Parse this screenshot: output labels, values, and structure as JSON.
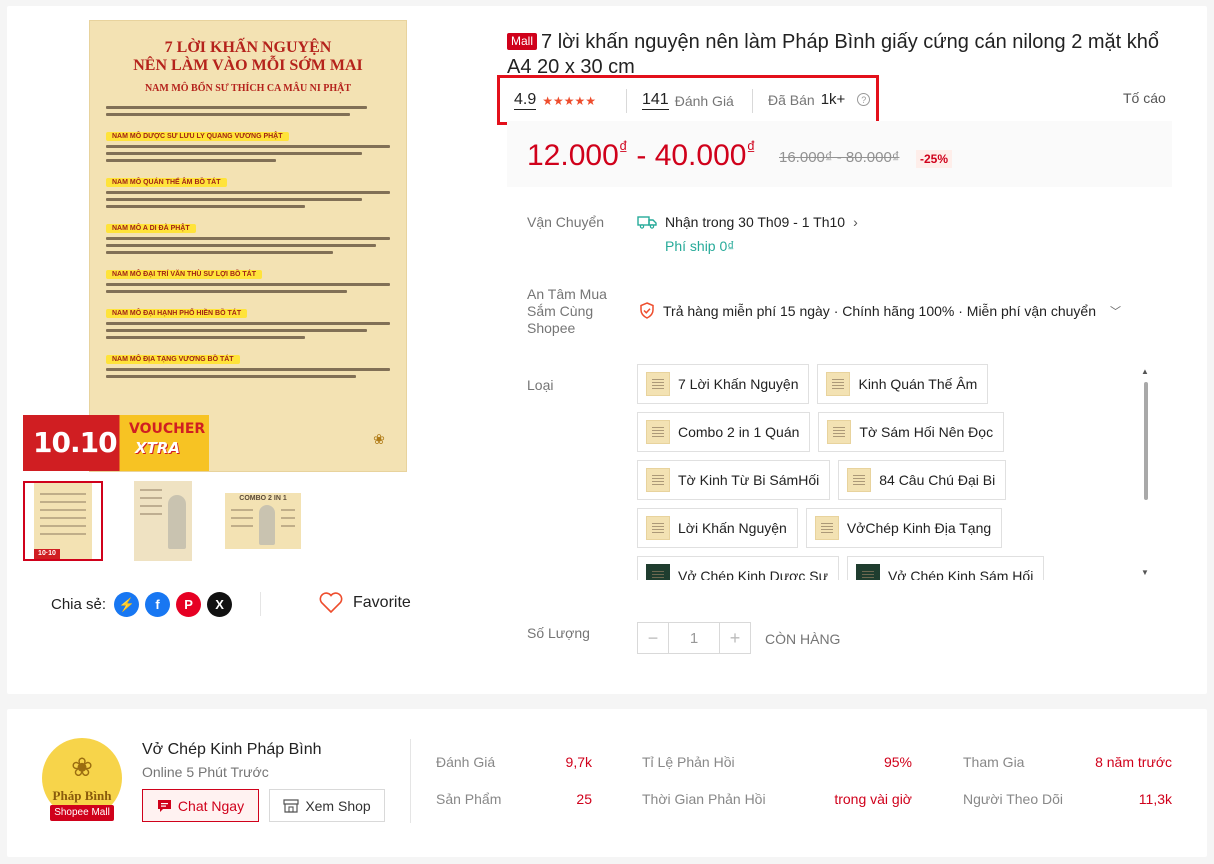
{
  "product": {
    "mall_tag": "Mall",
    "title": "7 lời khấn nguyện nên làm Pháp Bình giấy cứng cán nilong 2 mặt khổ A4 20 x 30 cm",
    "rating": "4.9",
    "rating_stars": 5,
    "reviews_count": "141",
    "reviews_label": "Đánh Giá",
    "sold_label": "Đã Bán",
    "sold_count": "1k+",
    "report_label": "Tố cáo",
    "price": "12.000",
    "price_max": "40.000",
    "currency": "₫",
    "old_price": "16.000₫ - 80.000₫",
    "discount": "-25%"
  },
  "poster": {
    "title_line1": "7 LỜI KHẤN NGUYỆN",
    "title_line2": "NÊN LÀM VÀO MỖI SỚM MAI",
    "subtitle": "NAM MÔ BỔN SƯ THÍCH CA MÂU NI PHẬT",
    "sections": [
      "NAM MÔ DƯỢC SƯ LƯU LY QUANG VƯƠNG PHẬT",
      "NAM MÔ QUÁN THẾ ÂM BỒ TÁT",
      "NAM MÔ A DI ĐÀ PHẬT",
      "NAM MÔ ĐẠI TRÍ VĂN THÙ SƯ LỢI BỒ TÁT",
      "NAM MÔ ĐẠI HẠNH PHỔ HIỀN BỒ TÁT",
      "NAM MÔ ĐỊA TẠNG VƯƠNG BỒ TÁT"
    ],
    "voucher_number": "10.10",
    "voucher_text": "VOUCHER",
    "voucher_xtra": "XTRA"
  },
  "thumbnails": {
    "badge": "10·10",
    "combo_label": "COMBO 2 IN 1"
  },
  "share": {
    "label": "Chia sẻ:",
    "favorite_label": "Favorite"
  },
  "shipping": {
    "label": "Vận Chuyển",
    "delivery": "Nhận trong 30 Th09 - 1 Th10",
    "fee": "Phí ship 0₫"
  },
  "guarantee": {
    "label_line1": "An Tâm Mua",
    "label_line2": "Sắm Cùng",
    "label_line3": "Shopee",
    "text": "Trả hàng miễn phí 15 ngày · Chính hãng 100% · Miễn phí vận chuyển"
  },
  "variants": {
    "label": "Loại",
    "rows": [
      [
        "7 Lời Khấn Nguyện",
        "Kinh Quán Thế Âm"
      ],
      [
        "Combo 2 in 1 Quán",
        "Tờ Sám Hối Nên Đọc"
      ],
      [
        "Tờ Kinh Từ Bi SámHối",
        "84 Câu Chú Đại Bi"
      ],
      [
        "Lời Khấn Nguyện",
        "VởChép Kinh Địa Tạng"
      ],
      [
        "Vở Chép Kinh Dược Sư",
        "Vở Chép Kinh Sám Hối"
      ]
    ]
  },
  "quantity": {
    "label": "Số Lượng",
    "value": "1",
    "stock": "CÒN HÀNG"
  },
  "shop": {
    "brand": "Pháp Bình",
    "mall_badge": "Shopee Mall",
    "name": "Vở Chép Kinh Pháp Bình",
    "online": "Online 5 Phút Trước",
    "chat_label": "Chat Ngay",
    "view_label": "Xem Shop",
    "stats": {
      "ratings_label": "Đánh Giá",
      "ratings": "9,7k",
      "products_label": "Sản Phẩm",
      "products": "25",
      "response_rate_label": "Tỉ Lệ Phản Hồi",
      "response_rate": "95%",
      "response_time_label": "Thời Gian Phản Hồi",
      "response_time": "trong vài giờ",
      "joined_label": "Tham Gia",
      "joined": "8 năm trước",
      "followers_label": "Người Theo Dõi",
      "followers": "11,3k"
    }
  },
  "colors": {
    "primary": "#d0011b",
    "highlight_border": "#e3101b",
    "ship_fee": "#26aa99",
    "star": "#ee4d2d"
  }
}
